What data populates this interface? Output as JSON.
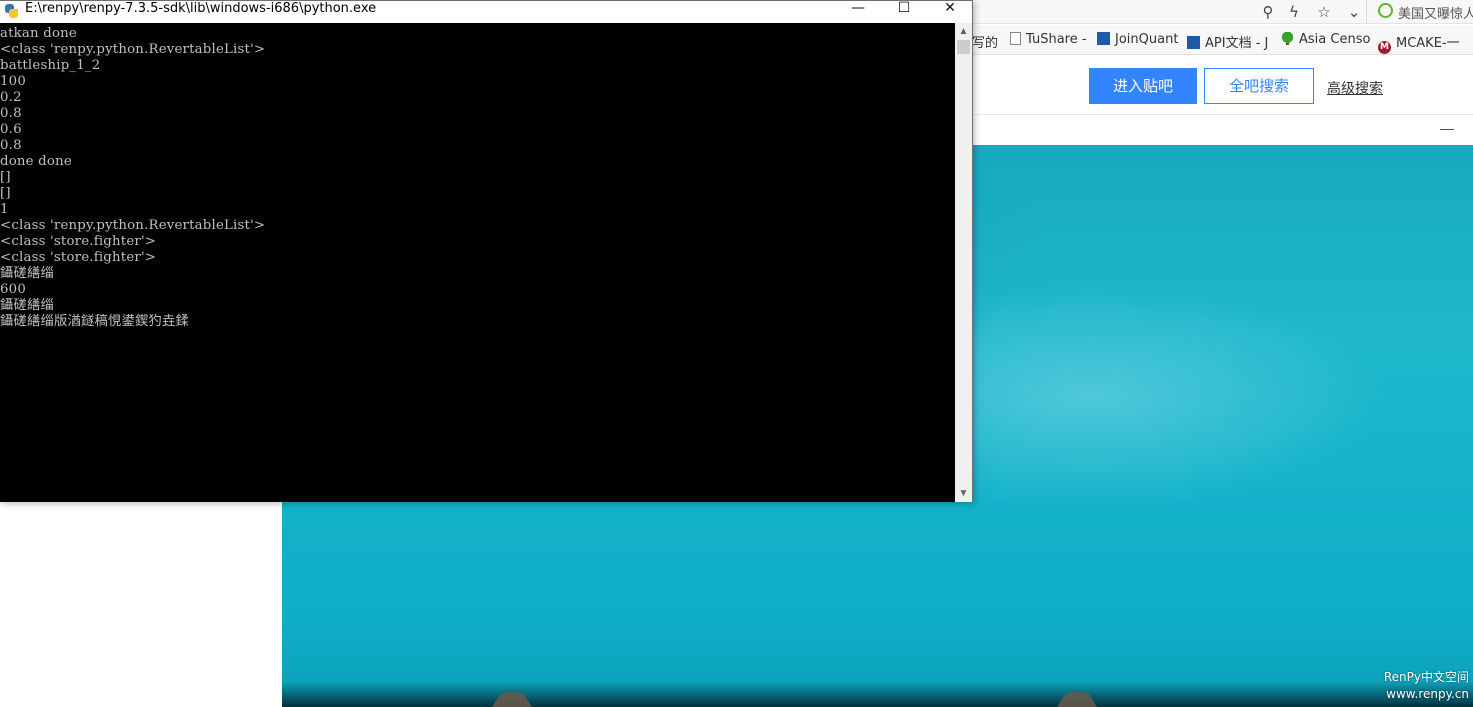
{
  "browser": {
    "toolbar_icons": [
      "zoom-icon",
      "lightning-icon",
      "star-icon",
      "chevron-down-icon"
    ],
    "news_text": "美国又曝惊人",
    "bookmarks": [
      {
        "label": "写的",
        "icon": "page-icon"
      },
      {
        "label": "TuShare -",
        "icon": "page-icon"
      },
      {
        "label": "JoinQuant",
        "icon": "chart-icon"
      },
      {
        "label": "API文档 - J",
        "icon": "chart-icon"
      },
      {
        "label": "Asia Censo",
        "icon": "tree-icon"
      },
      {
        "label": "MCAKE-一",
        "icon": "mcake-icon"
      }
    ],
    "enter_button": "进入贴吧",
    "search_button": "全吧搜索",
    "advanced_search": "高级搜索"
  },
  "game": {
    "minimize": "—",
    "watermark_line1": "RenPy中文空间",
    "watermark_line2": "www.renpy.cn"
  },
  "console": {
    "title": "E:\\renpy\\renpy-7.3.5-sdk\\lib\\windows-i686\\python.exe",
    "minimize": "—",
    "maximize": "☐",
    "close": "✕",
    "lines": [
      "atkan done",
      "<class 'renpy.python.RevertableList'>",
      "battleship_1_2",
      "100",
      "0.2",
      "0.8",
      "0.6",
      "0.8",
      "done done",
      "[]",
      "[]",
      "1",
      "<class 'renpy.python.RevertableList'>",
      "<class 'store.fighter'>",
      "<class 'store.fighter'>",
      "鑷磋繕缁",
      "600",
      "鑷磋繕缁",
      "鑷磋繕缁版湭鐩稿悓鍙鍥犳垚鍒"
    ]
  }
}
